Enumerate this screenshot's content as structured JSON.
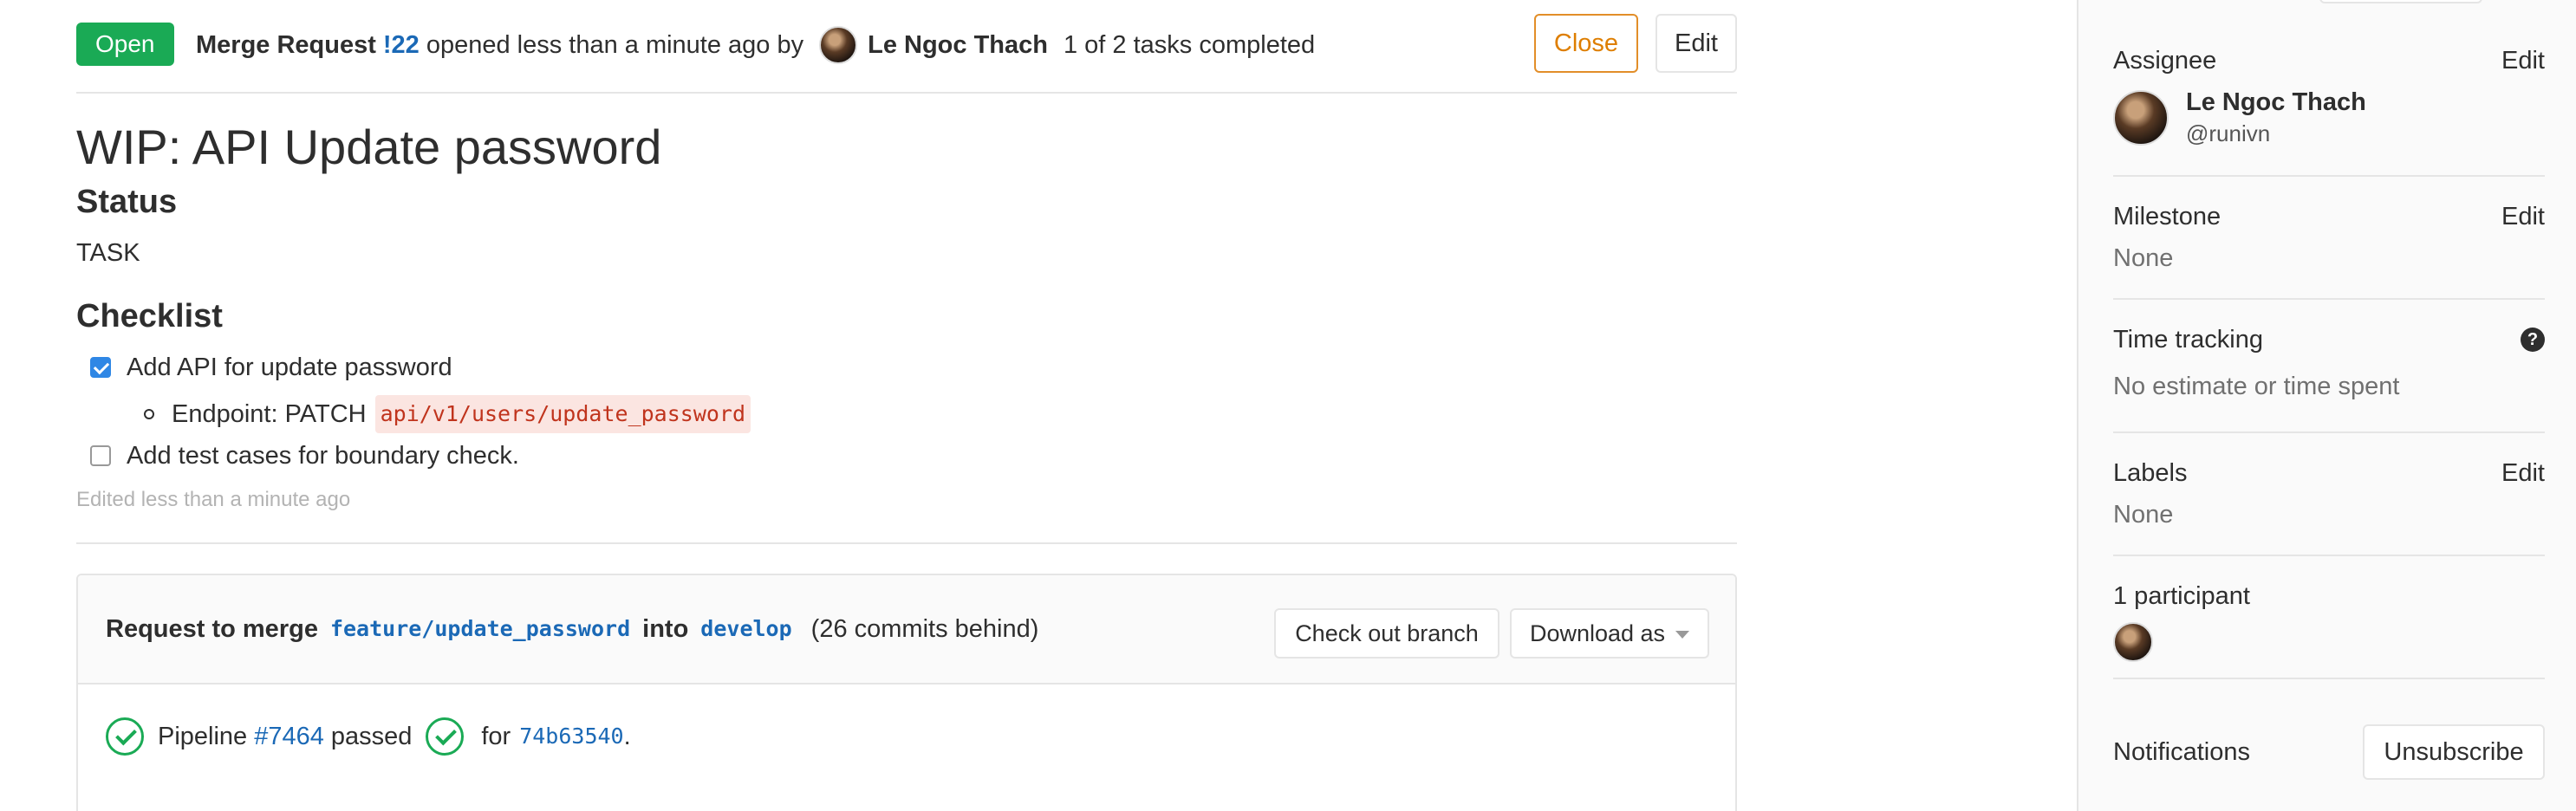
{
  "header": {
    "status_badge": "Open",
    "mr_label": "Merge Request",
    "mr_ref": "!22",
    "opened_text": "opened less than a minute ago by",
    "author": "Le Ngoc Thach",
    "tasks_text": "1 of 2 tasks completed",
    "close_button": "Close",
    "edit_button": "Edit"
  },
  "description": {
    "title": "WIP: API Update password",
    "status_heading": "Status",
    "status_value": "TASK",
    "checklist_heading": "Checklist",
    "tasks": [
      {
        "label": "Add API for update password",
        "checked": true
      },
      {
        "label": "Add test cases for boundary check.",
        "checked": false
      }
    ],
    "subitem_label": "Endpoint: PATCH",
    "subitem_code": "api/v1/users/update_password",
    "edited_text": "Edited less than a minute ago"
  },
  "merge_widget": {
    "request_text": "Request to merge",
    "source_branch": "feature/update_password",
    "into_text": "into",
    "target_branch": "develop",
    "behind_text": "(26 commits behind)",
    "checkout_button": "Check out branch",
    "download_button": "Download as",
    "pipeline_label": "Pipeline",
    "pipeline_id": "#7464",
    "pipeline_status": "passed",
    "for_text": "for",
    "commit_sha": "74b63540",
    "period": "."
  },
  "sidebar": {
    "assignee_title": "Assignee",
    "assignee_edit": "Edit",
    "assignee_name": "Le Ngoc Thach",
    "assignee_username": "@runivn",
    "milestone_title": "Milestone",
    "milestone_edit": "Edit",
    "milestone_value": "None",
    "time_tracking_title": "Time tracking",
    "time_tracking_help": "?",
    "time_tracking_value": "No estimate or time spent",
    "labels_title": "Labels",
    "labels_edit": "Edit",
    "labels_value": "None",
    "participants_title": "1 participant",
    "notifications_title": "Notifications",
    "unsubscribe_button": "Unsubscribe"
  },
  "colors": {
    "open_badge": "#1aaa55",
    "link": "#1b69b6",
    "close_button": "#de7e00",
    "pipeline_ok": "#1aaa55",
    "code_text": "#c0341d",
    "checkbox_checked": "#2f87e5"
  }
}
